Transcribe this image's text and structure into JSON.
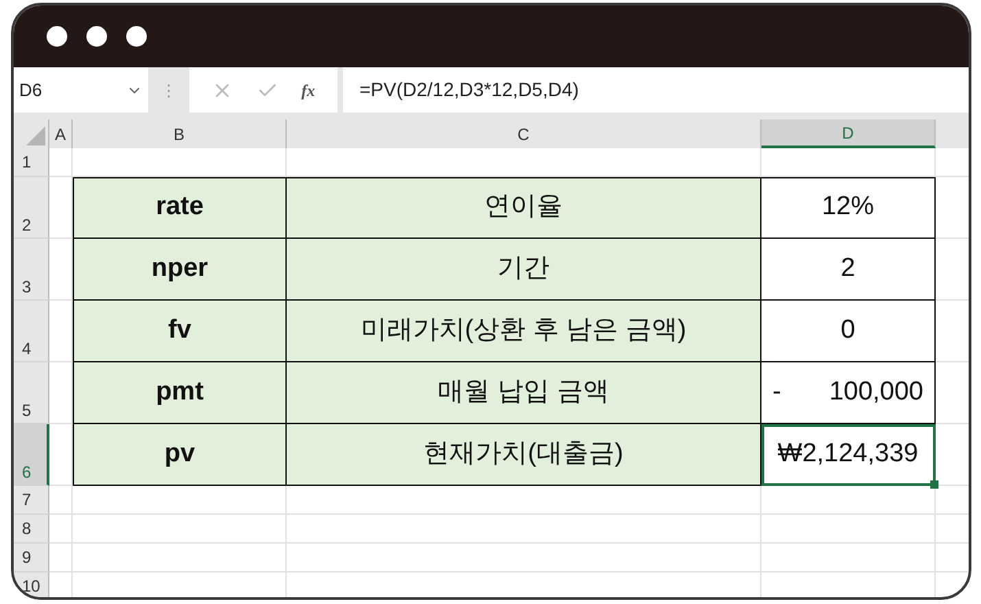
{
  "formula_bar": {
    "name_box": "D6",
    "more": "⋮",
    "function": "fx",
    "formula": "=PV(D2/12,D3*12,D5,D4)"
  },
  "columns": [
    {
      "label": "A",
      "selected": false
    },
    {
      "label": "B",
      "selected": false
    },
    {
      "label": "C",
      "selected": false
    },
    {
      "label": "D",
      "selected": true
    }
  ],
  "rows": [
    {
      "number": "1",
      "selected": false
    },
    {
      "number": "2",
      "selected": false,
      "cells": [
        {
          "text": "rate",
          "selected": false
        },
        {
          "text": "연이율",
          "selected": false
        },
        {
          "text": "12%",
          "selected": false
        }
      ]
    },
    {
      "number": "3",
      "selected": false,
      "cells": [
        {
          "text": "nper",
          "selected": false
        },
        {
          "text": "기간",
          "selected": false
        },
        {
          "text": "2",
          "selected": false
        }
      ]
    },
    {
      "number": "4",
      "selected": false,
      "cells": [
        {
          "text": "fv",
          "selected": false
        },
        {
          "text": "미래가치(상환 후 남은 금액)",
          "selected": false
        },
        {
          "text": "0",
          "selected": false
        }
      ]
    },
    {
      "number": "5",
      "selected": false,
      "cells": [
        {
          "text": "pmt",
          "selected": false
        },
        {
          "text": "매월 납입 금액",
          "selected": false
        },
        {
          "sign": "-",
          "text": "100,000",
          "selected": false
        }
      ]
    },
    {
      "number": "6",
      "selected": true,
      "cells": [
        {
          "text": "pv",
          "selected": false
        },
        {
          "text": "현재가치(대출금)",
          "selected": false
        },
        {
          "text": "₩2,124,339",
          "selected": true
        }
      ]
    },
    {
      "number": "7",
      "selected": false
    },
    {
      "number": "8",
      "selected": false
    },
    {
      "number": "9",
      "selected": false
    },
    {
      "number": "10",
      "selected": false
    }
  ]
}
